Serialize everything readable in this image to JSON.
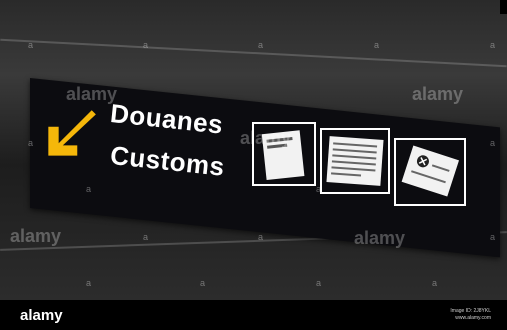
{
  "sign": {
    "french": "Douanes",
    "english": "Customs"
  },
  "watermark": "alamy",
  "footer": {
    "logo": "alamy",
    "line1": "Image ID: 2J8YKL",
    "line2": "www.alamy.com"
  },
  "colors": {
    "arrow": "#f5b70a",
    "sign_bg": "#0c0c10"
  }
}
